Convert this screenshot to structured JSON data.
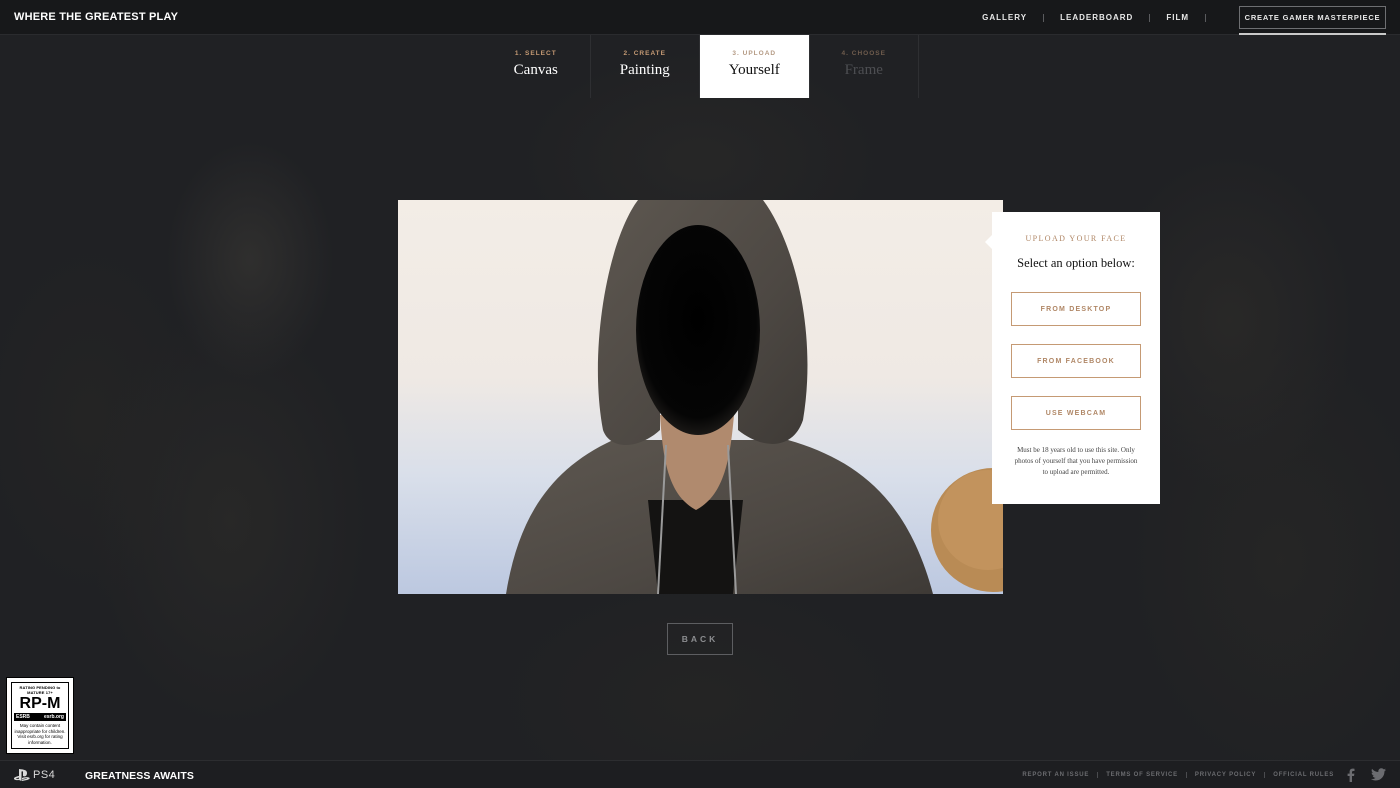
{
  "header": {
    "logo": "WHERE THE GREATEST PLAY",
    "nav": [
      {
        "label": "GALLERY"
      },
      {
        "label": "LEADERBOARD"
      },
      {
        "label": "FILM"
      }
    ],
    "cta": "CREATE GAMER MASTERPIECE"
  },
  "steps": [
    {
      "num": "1. SELECT",
      "name": "Canvas",
      "state": "done"
    },
    {
      "num": "2. CREATE",
      "name": "Painting",
      "state": "done"
    },
    {
      "num": "3. UPLOAD",
      "name": "Yourself",
      "state": "active"
    },
    {
      "num": "4. CHOOSE",
      "name": "Frame",
      "state": "disabled"
    }
  ],
  "upload_panel": {
    "title": "UPLOAD YOUR FACE",
    "subtitle": "Select an option below:",
    "options": [
      {
        "label": "FROM DESKTOP"
      },
      {
        "label": "FROM FACEBOOK"
      },
      {
        "label": "USE WEBCAM"
      }
    ],
    "note": "Must be 18 years old to use this site. Only photos of yourself that you have permission to upload are permitted."
  },
  "back_label": "BACK",
  "rating": {
    "top": "RATING PENDING to MATURE 17+",
    "code": "RP-M",
    "esrb": "ESRB",
    "esrb_site": "esrb.org",
    "note": "May contain content inappropriate for children. Visit esrb.org for rating information."
  },
  "footer": {
    "platform": "PS4",
    "tagline": "GREATNESS AWAITS",
    "links": [
      {
        "label": "REPORT AN ISSUE"
      },
      {
        "label": "TERMS OF SERVICE"
      },
      {
        "label": "PRIVACY POLICY"
      },
      {
        "label": "OFFICIAL RULES"
      }
    ],
    "social": [
      "facebook-icon",
      "twitter-icon"
    ]
  },
  "colors": {
    "accent": "#c59a74",
    "background": "#202124",
    "topbar": "#17181a"
  }
}
